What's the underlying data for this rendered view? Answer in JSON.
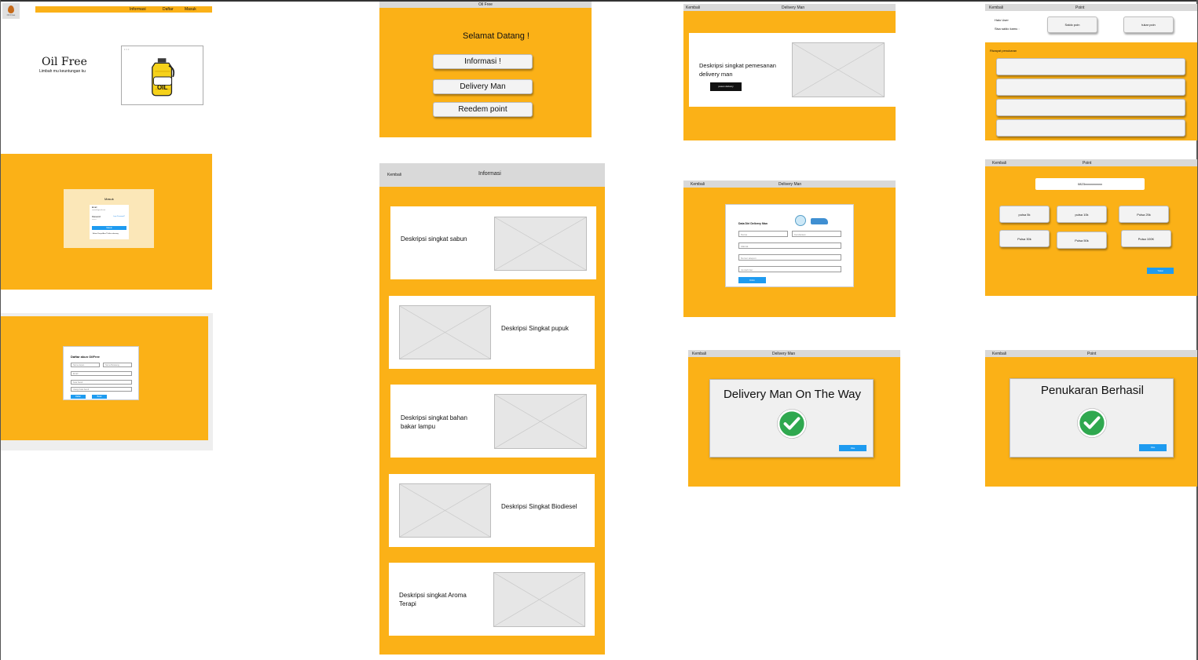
{
  "app": {
    "logo_label": "Oil Free"
  },
  "landing": {
    "nav": [
      "Informasi",
      "Daftar",
      "Masuk"
    ],
    "title": "Oil Free",
    "subtitle": "Limbah mu keuntungan ku",
    "jug_label": "OIL"
  },
  "login": {
    "title": "Masuk",
    "email_label": "Email",
    "email_value": "contoh@gmail.com",
    "password_label": "Password",
    "forgot": "Lupa Password?",
    "password_value": "••••••••",
    "submit": "Masuk",
    "register_prompt": "Belum Punya Akun? Daftar sekarang"
  },
  "register": {
    "title": "Daftar akun OilFree",
    "fields": [
      "Nama depan",
      "Nama Belakang",
      "Email",
      "Kata Sandi",
      "Ulangi Kata Sandi"
    ],
    "buttons": [
      "Daftar",
      "Batal"
    ]
  },
  "welcome": {
    "header": "Oil Free",
    "greeting": "Selamat Datang !",
    "buttons": [
      "Informasi !",
      "Delivery Man",
      "Reedem point"
    ]
  },
  "informasi": {
    "back": "Kembali",
    "title": "Informasi",
    "items": [
      "Deskripsi singkat sabun",
      "Deskripsi Singkat pupuk",
      "Deskripsi singkat bahan bakar lampu",
      "Deskripsi Singkat Biodiesel",
      "Deskripsi singkat Aroma Terapi"
    ]
  },
  "delivery": {
    "back": "Kembali",
    "title": "Delivery Man",
    "desc": "Deskripsi singkat pemesanan delivery man",
    "order_btn": "pesan delivery"
  },
  "delivery_form": {
    "back": "Kembali",
    "title": "Delivery Man",
    "form_title": "Data Diri Delivery Man",
    "fields": [
      "Nama",
      "Kendaraan",
      "Alamat",
      "Nomor telepon",
      "Jumlah liter"
    ],
    "submit": "Kirim"
  },
  "delivery_done": {
    "back": "Kembali",
    "title": "Delivery Man",
    "message": "Delivery Man On The Way",
    "ok": "Oke"
  },
  "point": {
    "back": "Kembali",
    "title": "Point",
    "hello": "Halo User",
    "balance": "Sisa saldo kamu :",
    "saldo_btn": "Saldo poin",
    "tukar_btn": "tukar poin",
    "history_label": "Riwayat penukaran"
  },
  "redeem": {
    "back": "Kembali",
    "title": "Point",
    "phone": "0823xxxxxxxxxxx",
    "options": [
      "pulsa 5k",
      "pulsa 10k",
      "Pulsa 25k",
      "Pulsa 30k",
      "Pulsa 50k",
      "Pulsa 100K"
    ],
    "submit": "Tukar"
  },
  "redeem_done": {
    "back": "Kembali",
    "title": "Point",
    "message": "Penukaran Berhasil",
    "ok": "Oke"
  }
}
